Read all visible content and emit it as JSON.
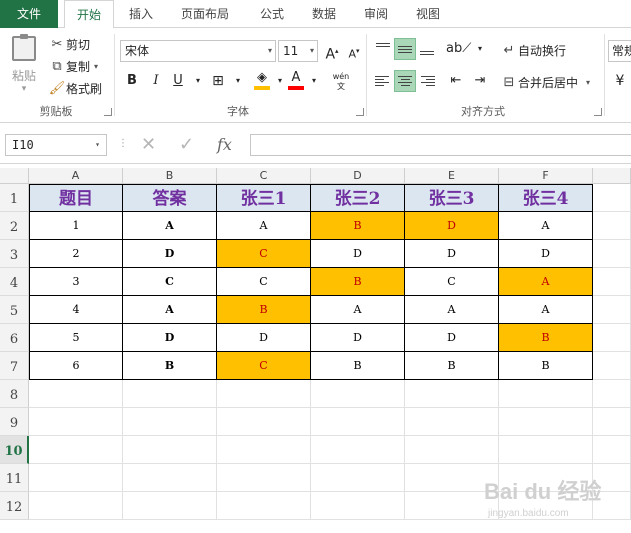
{
  "tabs": {
    "file": "文件",
    "home": "开始",
    "insert": "插入",
    "page_layout": "页面布局",
    "formulas": "公式",
    "data": "数据",
    "review": "审阅",
    "view": "视图"
  },
  "clipboard": {
    "paste": "粘贴",
    "cut": "剪切",
    "copy": "复制",
    "format_painter": "格式刷",
    "group_label": "剪贴板"
  },
  "font": {
    "name": "宋体",
    "size": "11",
    "bold": "B",
    "italic": "I",
    "underline": "U",
    "font_color_glyph": "A",
    "font_color": "#ff0000",
    "fill_color": "#ffc000",
    "pinyin": "wén",
    "group_label": "字体"
  },
  "alignment": {
    "wrap_text": "自动换行",
    "merge_center": "合并后居中",
    "group_label": "对齐方式"
  },
  "number": {
    "format": "常规"
  },
  "formula_bar": {
    "name_box": "I10",
    "fx": "fx",
    "formula": ""
  },
  "sheet": {
    "columns": [
      "A",
      "B",
      "C",
      "D",
      "E",
      "F"
    ],
    "rows": [
      "1",
      "2",
      "3",
      "4",
      "5",
      "6",
      "7",
      "8",
      "9",
      "10",
      "11",
      "12"
    ],
    "selected_row": "10",
    "header": [
      "题目",
      "答案",
      "张三1",
      "张三2",
      "张三3",
      "张三4"
    ],
    "data": [
      [
        "1",
        "A",
        "A",
        "B",
        "D",
        "A"
      ],
      [
        "2",
        "D",
        "C",
        "D",
        "D",
        "D"
      ],
      [
        "3",
        "C",
        "C",
        "B",
        "C",
        "A"
      ],
      [
        "4",
        "A",
        "B",
        "A",
        "A",
        "A"
      ],
      [
        "5",
        "D",
        "D",
        "D",
        "D",
        "B"
      ],
      [
        "6",
        "B",
        "C",
        "B",
        "B",
        "B"
      ]
    ],
    "highlights": [
      [
        0,
        3
      ],
      [
        0,
        4
      ],
      [
        1,
        2
      ],
      [
        2,
        3
      ],
      [
        2,
        5
      ],
      [
        3,
        2
      ],
      [
        4,
        5
      ],
      [
        5,
        2
      ]
    ],
    "header_fill": "#dce6f1",
    "header_text_color": "#7030a0",
    "highlight_fill": "#ffc000",
    "highlight_text": "#c00000"
  },
  "watermark": {
    "main": "Bai du 经验",
    "sub": "jingyan.baidu.com"
  }
}
